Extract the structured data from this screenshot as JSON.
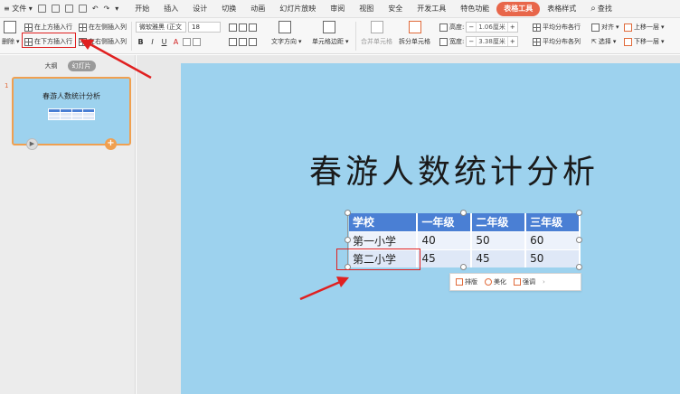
{
  "menubar": {
    "file_label": "≡ 文件",
    "file_arrow": "▾",
    "tabs": [
      {
        "label": "开始"
      },
      {
        "label": "插入"
      },
      {
        "label": "设计"
      },
      {
        "label": "切换"
      },
      {
        "label": "动画"
      },
      {
        "label": "幻灯片放映"
      },
      {
        "label": "审阅"
      },
      {
        "label": "视图"
      },
      {
        "label": "安全"
      },
      {
        "label": "开发工具"
      },
      {
        "label": "特色功能"
      },
      {
        "label": "表格工具"
      },
      {
        "label": "表格样式"
      },
      {
        "label": "查找"
      }
    ],
    "active_tab": "表格工具"
  },
  "ribbon": {
    "insert_above": "在上方插入行",
    "insert_below": "在下方插入行",
    "insert_left": "在左侧插入列",
    "insert_right": "在右侧插入列",
    "delete_label": "删除",
    "font_name": "微软雅黑 (正文",
    "font_size": "18",
    "bold": "B",
    "italic": "I",
    "underline": "U",
    "font_color": "A",
    "text_direction": "文字方向",
    "cell_margin": "单元格边距",
    "merge_cells": "合并单元格",
    "split_cells": "拆分单元格",
    "height_label": "高度:",
    "height_value": "1.06厘米",
    "width_label": "宽度:",
    "width_value": "3.38厘米",
    "minus": "−",
    "plus": "+",
    "distribute_rows": "平均分布各行",
    "distribute_cols": "平均分布各列",
    "align": "对齐",
    "select": "选择",
    "bring_forward": "上移一层",
    "send_backward": "下移一层"
  },
  "left_panel": {
    "tab_outline": "大纲",
    "tab_slides": "幻灯片",
    "slide_number": "1",
    "thumb_title": "春游人数统计分析",
    "play_icon": "▶",
    "add_icon": "+"
  },
  "slide": {
    "title": "春游人数统计分析",
    "table": {
      "headers": [
        "学校",
        "一年级",
        "二年级",
        "三年级"
      ],
      "rows": [
        [
          "第一小学",
          "40",
          "50",
          "60"
        ],
        [
          "第二小学",
          "45",
          "45",
          "50"
        ]
      ]
    }
  },
  "float_toolbar": {
    "layout": "排版",
    "beautify": "美化",
    "strong_adjust": "强调",
    "more": "›"
  },
  "colors": {
    "accent_tab": "#e8664a",
    "slide_bg": "#9dd2ee",
    "table_header": "#4a7fd4",
    "table_cell": "#dfe8f7",
    "annotation_red": "#e02020"
  }
}
